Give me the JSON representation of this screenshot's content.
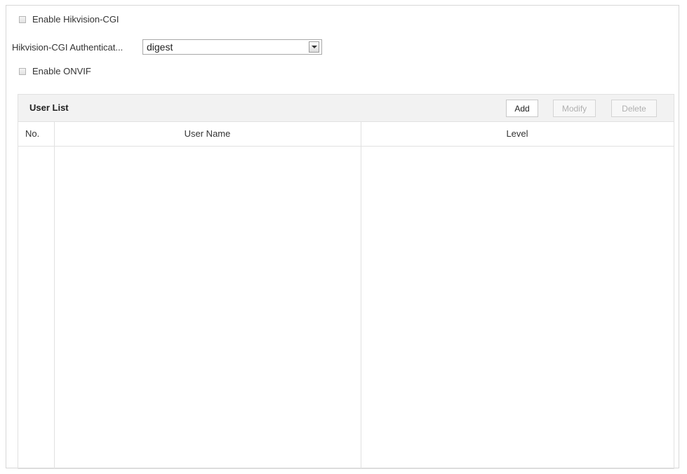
{
  "settings": {
    "hikvision_cgi": {
      "label": "Enable Hikvision-CGI",
      "checked": false
    },
    "authentication": {
      "label": "Hikvision-CGI Authenticat...",
      "value": "digest"
    },
    "onvif": {
      "label": "Enable ONVIF",
      "checked": false
    }
  },
  "user_list": {
    "title": "User List",
    "buttons": {
      "add": "Add",
      "modify": "Modify",
      "delete": "Delete"
    },
    "columns": {
      "no": "No.",
      "user_name": "User Name",
      "level": "Level"
    },
    "rows": []
  },
  "icons": {
    "checkbox": "checkbox-icon",
    "dropdown_arrow": "chevron-down-icon"
  }
}
